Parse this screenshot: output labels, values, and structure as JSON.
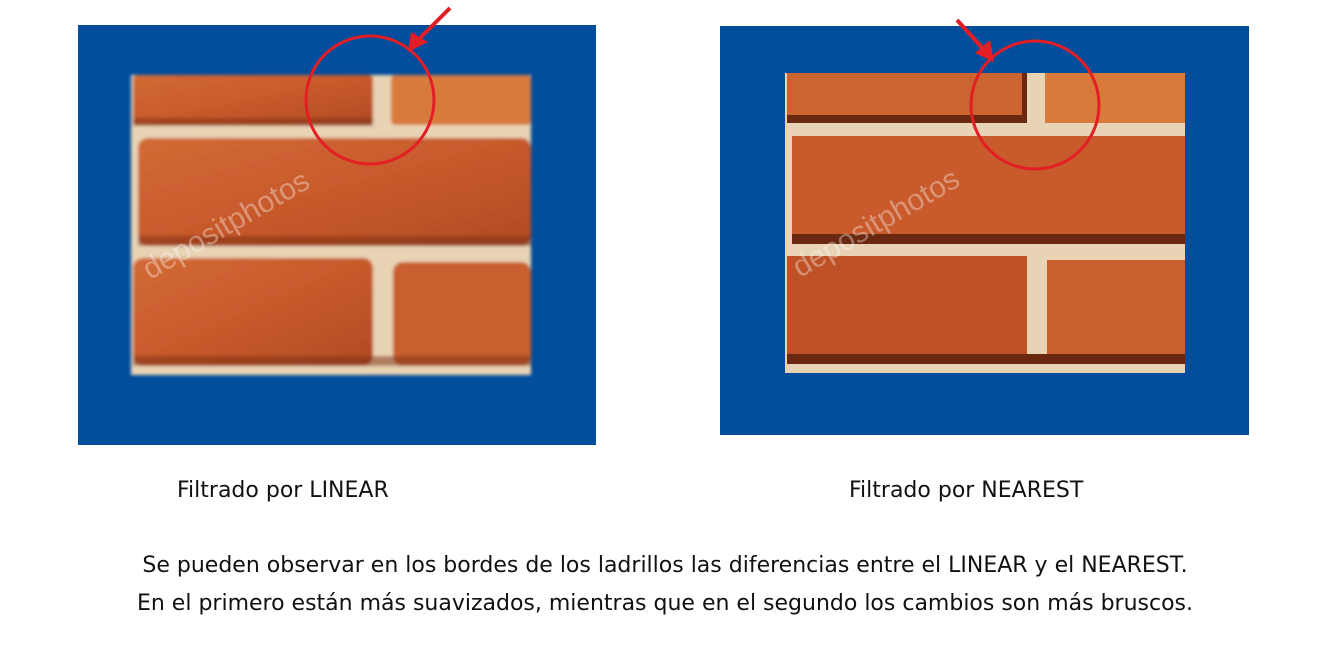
{
  "panels": [
    {
      "id": "linear",
      "caption": "Filtrado por LINEAR",
      "watermark": "depositphotos",
      "frame_color": "#034D9D",
      "smooth": true
    },
    {
      "id": "nearest",
      "caption": "Filtrado por NEAREST",
      "watermark": "depositphotos",
      "frame_color": "#034D9D",
      "smooth": false
    }
  ],
  "highlight_color": "#E31E24",
  "description": {
    "line1": "Se pueden observar en los bordes de los ladrillos las diferencias entre el LINEAR y el NEAREST.",
    "line2": "En el primero están más suavizados, mientras que en el segundo los cambios son más bruscos."
  }
}
